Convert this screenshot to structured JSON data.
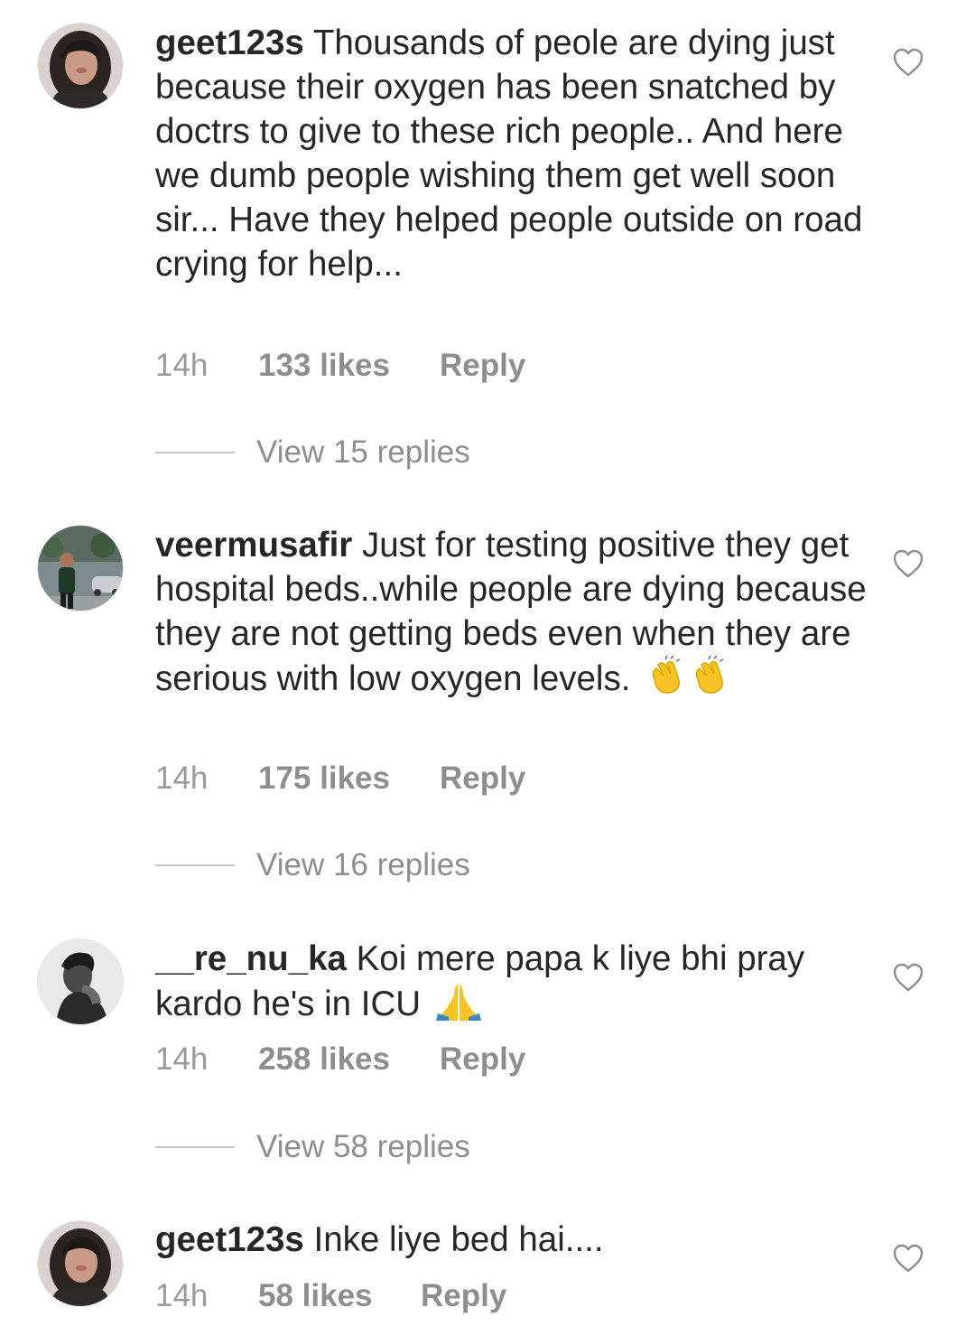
{
  "comments": [
    {
      "username": "geet123s",
      "text": "Thousands of peole are dying just because their oxygen has been snatched by doctrs to give to these rich people.. And here we dumb people wishing them get well soon sir... Have they helped people outside on road crying for help...",
      "time": "14h",
      "likes": "133 likes",
      "reply": "Reply",
      "view_replies": "View 15 replies",
      "avatar_icon": "woman-avatar-photo"
    },
    {
      "username": "veermusafir",
      "text": "Just for testing positive they get hospital beds..while people are dying because they are not getting beds even when they are serious with low oxygen levels.",
      "emojis": [
        "clapping-hands-emoji",
        "clapping-hands-emoji"
      ],
      "time": "14h",
      "likes": "175 likes",
      "reply": "Reply",
      "view_replies": "View 16 replies",
      "avatar_icon": "man-outdoor-avatar-photo"
    },
    {
      "username": "__re_nu_ka",
      "text": "Koi mere papa k liye bhi pray kardo he's in ICU",
      "emojis": [
        "folded-hands-emoji"
      ],
      "time": "14h",
      "likes": "258 likes",
      "reply": "Reply",
      "view_replies": "View 58 replies",
      "avatar_icon": "bw-portrait-avatar-photo"
    },
    {
      "username": "geet123s",
      "text": "Inke liye bed hai....",
      "time": "14h",
      "likes": "58 likes",
      "reply": "Reply",
      "avatar_icon": "woman-avatar-photo"
    }
  ],
  "colors": {
    "text": "#262626",
    "secondary": "#8e8e8e",
    "divider": "#c7c7c7",
    "emoji_yellow": "#f7c325",
    "emoji_blue": "#3b88c3"
  },
  "icons": {
    "like": "heart-outline-icon"
  }
}
